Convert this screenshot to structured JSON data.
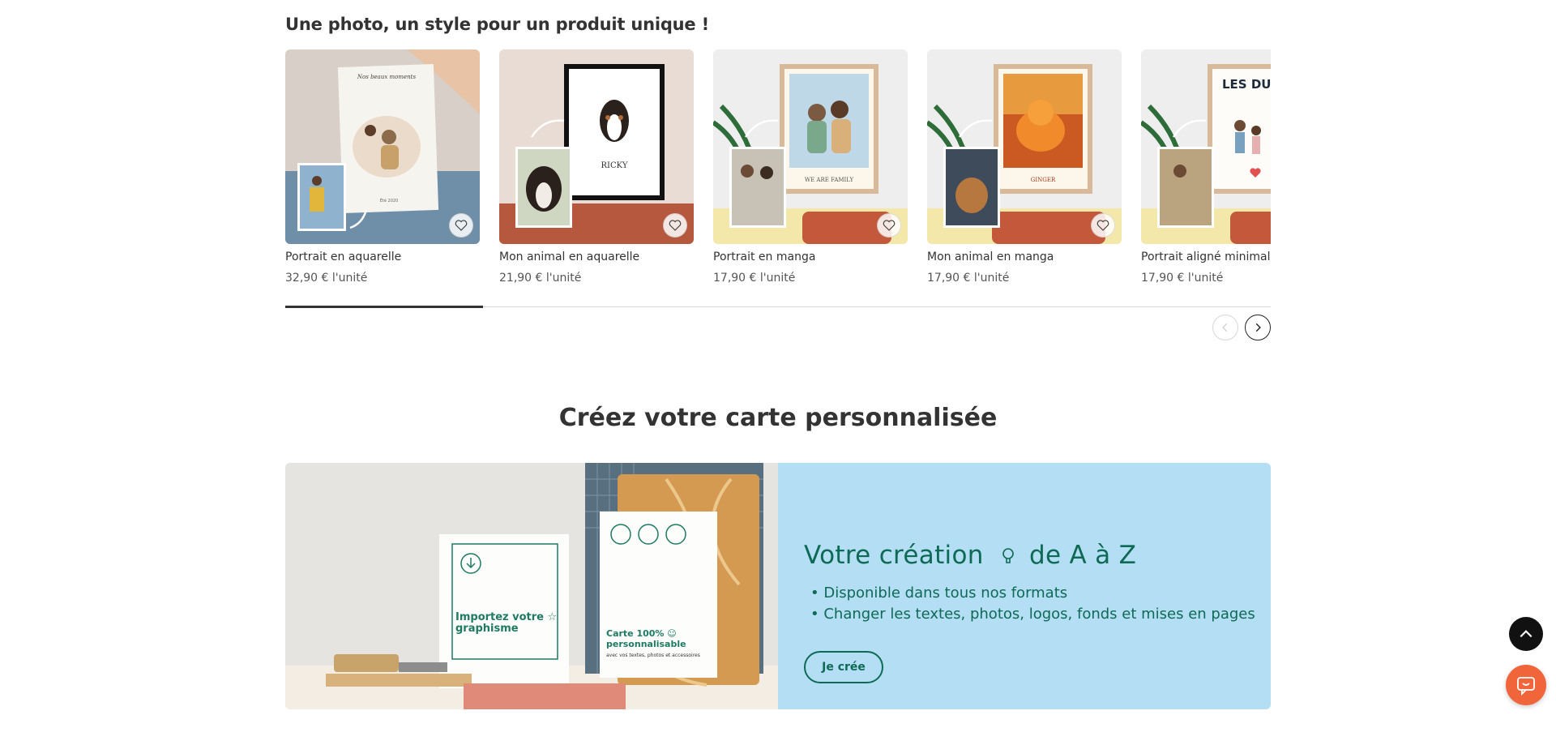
{
  "section": {
    "title": "Une photo, un style pour un produit unique !"
  },
  "products": [
    {
      "name": "Portrait en aquarelle",
      "price": "32,90 € l'unité",
      "thumb_text": "Nos beaux moments",
      "thumb_year": "Été 2020"
    },
    {
      "name": "Mon animal en aquarelle",
      "price": "21,90 € l'unité",
      "thumb_text": "RICKY"
    },
    {
      "name": "Portrait en manga",
      "price": "17,90 € l'unité",
      "thumb_text": "WE ARE FAMILY"
    },
    {
      "name": "Mon animal en manga",
      "price": "17,90 € l'unité",
      "thumb_text": "GINGER"
    },
    {
      "name": "Portrait aligné minimaliste",
      "price": "17,90 € l'unité",
      "thumb_text": "LES DUPUIS"
    }
  ],
  "carousel": {
    "progress": 0.2,
    "prev_icon": "chevron-left-icon",
    "next_icon": "chevron-right-icon"
  },
  "card_section": {
    "title": "Créez votre carte personnalisée",
    "banner": {
      "headline_main": "Votre création",
      "headline_sub": "de A à Z",
      "bullets": [
        "Disponible dans tous nos formats",
        "Changer les textes, photos, logos, fonds et mises en pages"
      ],
      "cta_label": "Je crée",
      "card_left_text": "Importez votre ☆ graphisme",
      "card_right_text": "Carte 100% ☺ personnalisable",
      "card_right_small": "avec vos textes, photos et accessoires"
    }
  },
  "colors": {
    "accent_green": "#0e6a55",
    "panel_blue": "#b3def3",
    "chat_orange": "#f0663a"
  }
}
